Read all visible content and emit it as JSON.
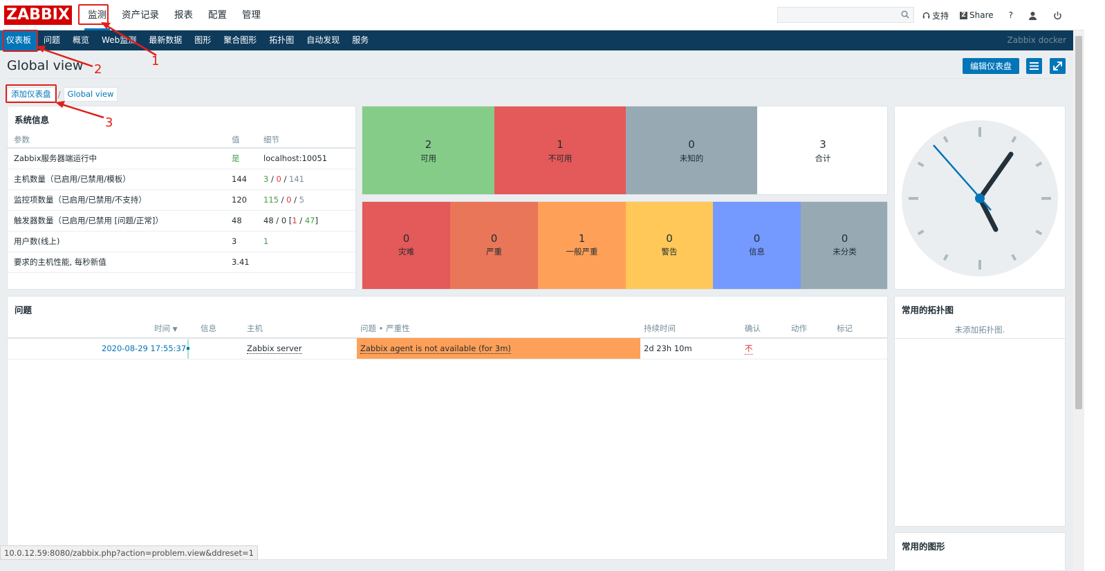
{
  "header": {
    "logo": "ZABBIX",
    "menu": [
      {
        "label": "监测",
        "selected": true
      },
      {
        "label": "资产记录"
      },
      {
        "label": "报表"
      },
      {
        "label": "配置"
      },
      {
        "label": "管理"
      }
    ],
    "search_placeholder": "",
    "links": {
      "support": "支持",
      "share": "Share",
      "share_icon": "Z",
      "help": "?"
    }
  },
  "subnav": {
    "items": [
      {
        "label": "仪表板",
        "selected": true
      },
      {
        "label": "问题"
      },
      {
        "label": "概览"
      },
      {
        "label": "Web监测"
      },
      {
        "label": "最新数据"
      },
      {
        "label": "图形"
      },
      {
        "label": "聚合图形"
      },
      {
        "label": "拓扑图"
      },
      {
        "label": "自动发现"
      },
      {
        "label": "服务"
      }
    ],
    "instance": "Zabbix docker"
  },
  "page": {
    "title": "Global view",
    "edit_button": "编辑仪表盘",
    "breadcrumb": [
      "添加仪表盘",
      "Global view"
    ],
    "breadcrumb_sep": "/"
  },
  "sysinfo": {
    "title": "系统信息",
    "headers": [
      "参数",
      "值",
      "细节"
    ],
    "rows": [
      {
        "param": "Zabbix服务器端运行中",
        "value": "是",
        "detail": "localhost:10051"
      },
      {
        "param": "主机数量（已启用/已禁用/模板）",
        "value": "144",
        "d1": "3",
        "d2": "0",
        "d3": "141"
      },
      {
        "param": "监控项数量（已启用/已禁用/不支持）",
        "value": "120",
        "d1": "115",
        "d2": "0",
        "d3": "5"
      },
      {
        "param": "触发器数量（已启用/已禁用 [问题/正常]）",
        "value": "48",
        "d1": "48",
        "d2": "0",
        "d3": "1",
        "d4": "47"
      },
      {
        "param": "用户数(线上)",
        "value": "3",
        "detail": "1"
      },
      {
        "param": "要求的主机性能, 每秒新值",
        "value": "3.41",
        "detail": ""
      }
    ]
  },
  "host_availability": [
    {
      "num": "2",
      "label": "可用",
      "color": "#86cc89"
    },
    {
      "num": "1",
      "label": "不可用",
      "color": "#e45959"
    },
    {
      "num": "0",
      "label": "未知的",
      "color": "#97aab3"
    },
    {
      "num": "3",
      "label": "合计",
      "color": "#ffffff"
    }
  ],
  "severity": [
    {
      "num": "0",
      "label": "灾难",
      "color": "#e45959"
    },
    {
      "num": "0",
      "label": "严重",
      "color": "#e97659"
    },
    {
      "num": "1",
      "label": "一般严重",
      "color": "#ffa059"
    },
    {
      "num": "0",
      "label": "警告",
      "color": "#ffc859"
    },
    {
      "num": "0",
      "label": "信息",
      "color": "#7499ff"
    },
    {
      "num": "0",
      "label": "未分类",
      "color": "#97aab3"
    }
  ],
  "problems": {
    "title": "问题",
    "headers": {
      "time": "时间",
      "sort_arrow": "▼",
      "info": "信息",
      "host": "主机",
      "problem": "问题 • 严重性",
      "duration": "持续时间",
      "ack": "确认",
      "actions": "动作",
      "tags": "标记"
    },
    "rows": [
      {
        "time": "2020-08-29 17:55:37",
        "host": "Zabbix server",
        "problem": "Zabbix agent is not available (for 3m)",
        "duration": "2d 23h 10m",
        "ack": "不"
      }
    ]
  },
  "maps_widget": {
    "title": "常用的拓扑图",
    "empty": "未添加拓扑图."
  },
  "graphs_widget": {
    "title": "常用的图形"
  },
  "statusbar": "10.0.12.59:8080/zabbix.php?action=problem.view&ddreset=1",
  "annotations": [
    "1",
    "2",
    "3"
  ]
}
